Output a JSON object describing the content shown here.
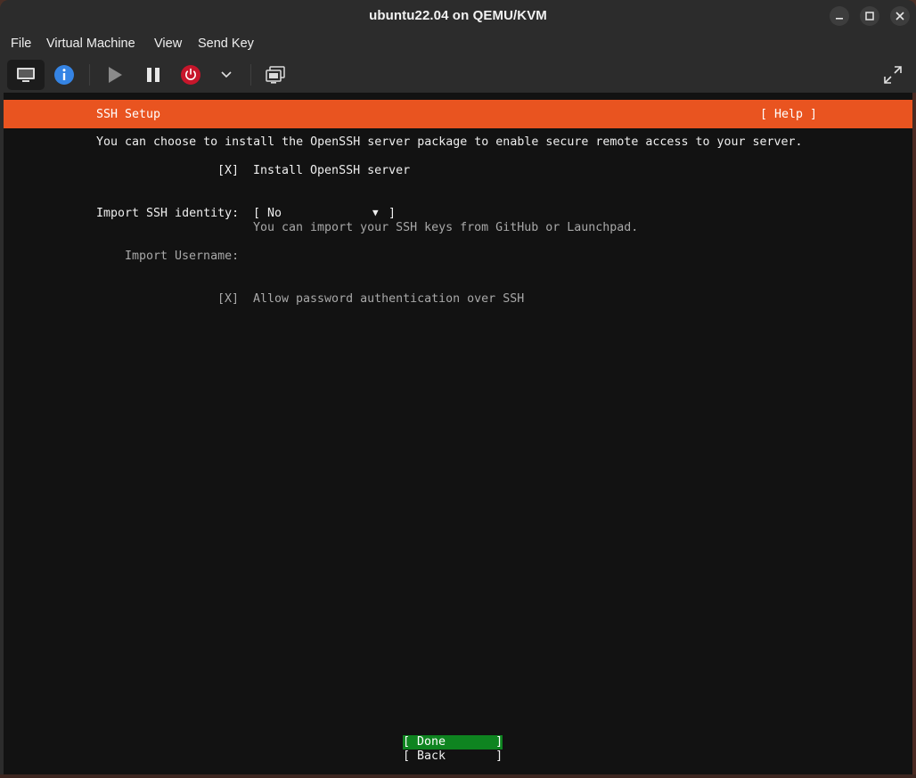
{
  "window": {
    "title": "ubuntu22.04 on QEMU/KVM",
    "controls": [
      "minimize-icon",
      "maximize-icon",
      "close-icon"
    ]
  },
  "menubar": {
    "items": [
      "File",
      "Virtual Machine",
      "View",
      "Send Key"
    ]
  },
  "toolbar": {
    "buttons": [
      "monitor-icon",
      "info-icon",
      "play-icon",
      "pause-icon",
      "power-icon",
      "chevron-down-icon",
      "screenshot-icon",
      "fullscreen-icon"
    ]
  },
  "installer": {
    "header_title": "SSH Setup",
    "help_label": "[ Help ]",
    "intro": "You can choose to install the OpenSSH server package to enable secure remote access to your server.",
    "install_checkbox": "[X]",
    "install_label": "Install OpenSSH server",
    "import_identity_label": "Import SSH identity:",
    "import_identity_open": "[",
    "import_identity_value": "No",
    "import_identity_arrow": "▼",
    "import_identity_close": "]",
    "import_identity_hint": "You can import your SSH keys from GitHub or Launchpad.",
    "import_username_label": "Import Username:",
    "password_auth_checkbox": "[X]",
    "password_auth_label": "Allow password authentication over SSH",
    "done_label": "[ Done       ]",
    "back_label": "[ Back       ]"
  },
  "colors": {
    "header_orange": "#e95420",
    "done_green": "#0e8420",
    "console_bg": "#121212",
    "info_blue": "#3584e4",
    "power_red": "#c7162b"
  }
}
